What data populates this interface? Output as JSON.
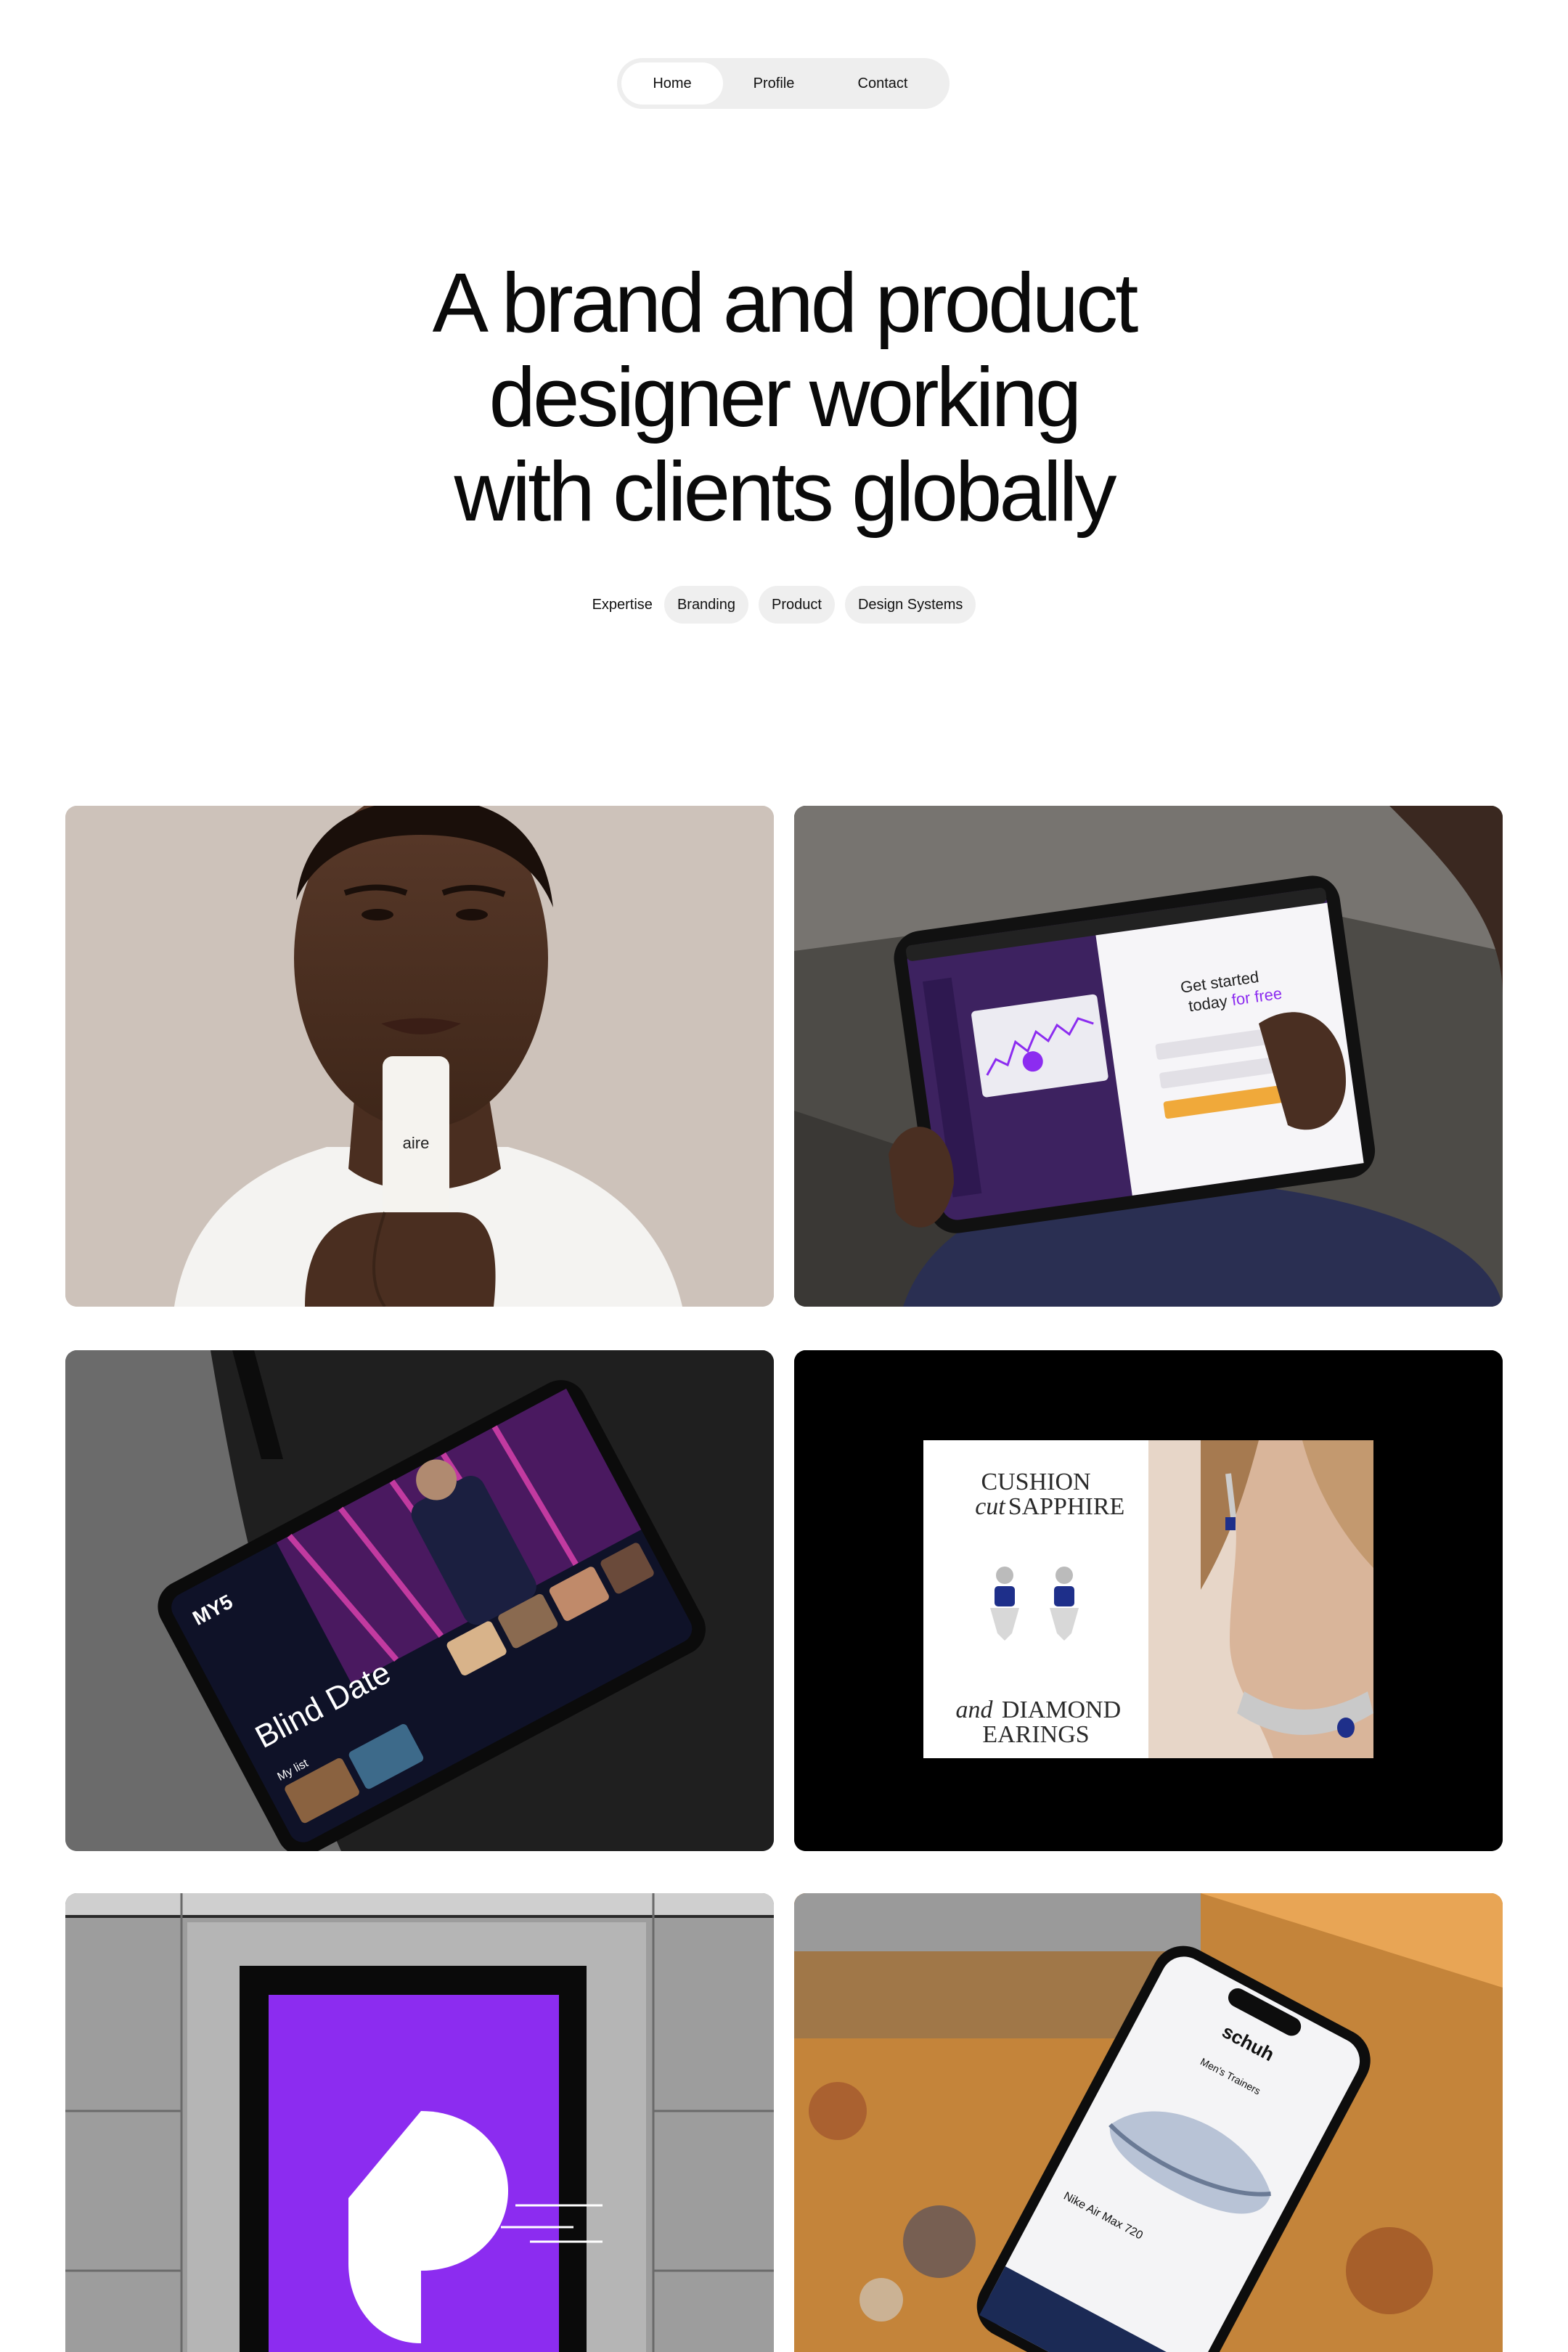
{
  "nav": {
    "items": [
      {
        "label": "Home",
        "active": true
      },
      {
        "label": "Profile",
        "active": false
      },
      {
        "label": "Contact",
        "active": false
      }
    ]
  },
  "hero": {
    "lines": [
      "A brand and product",
      "designer working",
      "with clients globally"
    ]
  },
  "expertise": {
    "label": "Expertise",
    "tags": [
      "Branding",
      "Product",
      "Design Systems"
    ]
  },
  "projects": {
    "aire": {
      "brand": "aire"
    },
    "correlated": {
      "headline_1": "Get started",
      "headline_2": "today",
      "headline_accent": "for free"
    },
    "my5": {
      "logo": "MY5",
      "title": "Blind Date",
      "row_label": "My list"
    },
    "jewellery": {
      "line1": "CUSHION",
      "line2_italic": "cut",
      "line2": "SAPPHIRE",
      "line3_italic": "and",
      "line3": "DIAMOND",
      "line4": "EARINGS"
    },
    "schuh": {
      "brand": "schuh",
      "category": "Men's Trainers",
      "product": "Nike Air Max 720"
    }
  },
  "colors": {
    "background": "#ffffff",
    "nav_bg": "#eeeeee",
    "pill_bg": "#efefef",
    "accent_purple": "#8c2cf0"
  }
}
